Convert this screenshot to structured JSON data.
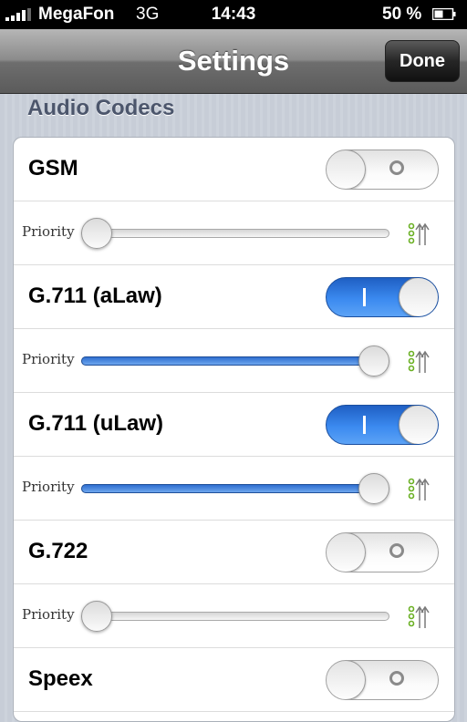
{
  "status_bar": {
    "carrier": "MegaFon",
    "network": "3G",
    "time": "14:43",
    "battery": "50 %",
    "battery_level": 0.5
  },
  "nav": {
    "title": "Settings",
    "done_label": "Done"
  },
  "section": {
    "title": "Audio Codecs"
  },
  "codecs": [
    {
      "name": "GSM",
      "enabled": false,
      "priority_label": "Priority",
      "priority": 0.0
    },
    {
      "name": "G.711 (aLaw)",
      "enabled": true,
      "priority_label": "Priority",
      "priority": 1.0
    },
    {
      "name": "G.711 (uLaw)",
      "enabled": true,
      "priority_label": "Priority",
      "priority": 1.0
    },
    {
      "name": "G.722",
      "enabled": false,
      "priority_label": "Priority",
      "priority": 0.0
    },
    {
      "name": "Speex",
      "enabled": false
    }
  ],
  "colors": {
    "accent_blue": "#3b8af0",
    "priority_icon_green": "#6ab023"
  }
}
